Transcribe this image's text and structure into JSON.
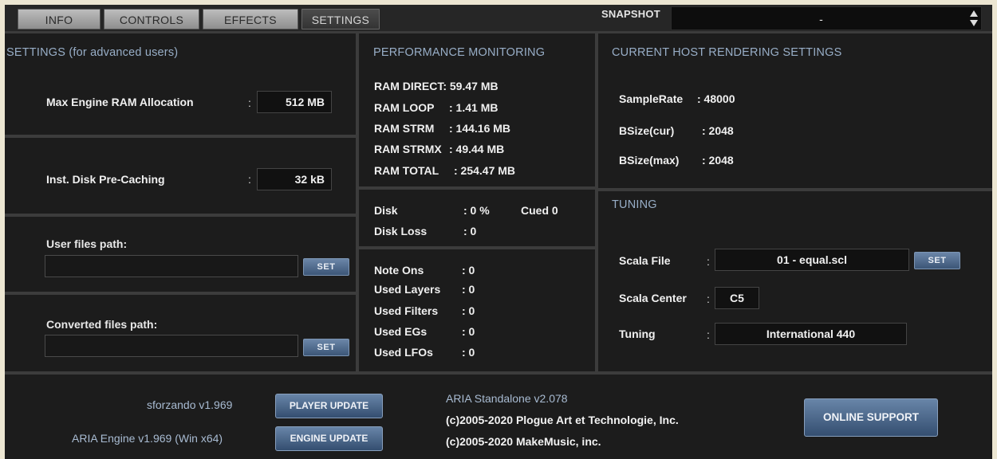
{
  "tabs": [
    "INFO",
    "CONTROLS",
    "EFFECTS",
    "SETTINGS"
  ],
  "snapshot": {
    "label": "SNAPSHOT",
    "value": "-"
  },
  "settings": {
    "title": "SETTINGS (for advanced users)",
    "ram": {
      "label": "Max Engine RAM Allocation",
      "value": "512 MB"
    },
    "disk": {
      "label": "Inst. Disk Pre-Caching",
      "value": "32 kB"
    },
    "user_path": {
      "label": "User files path:",
      "value": "",
      "button": "SET"
    },
    "converted_path": {
      "label": "Converted files path:",
      "value": "",
      "button": "SET"
    }
  },
  "performance": {
    "title": "PERFORMANCE MONITORING",
    "ram": [
      {
        "label": "RAM DIRECT",
        "value": ": 59.47 MB"
      },
      {
        "label": "RAM LOOP",
        "value": ": 1.41 MB"
      },
      {
        "label": "RAM STRM",
        "value": ": 144.16 MB"
      },
      {
        "label": "RAM STRMX",
        "value": ": 49.44 MB"
      },
      {
        "label": "RAM TOTAL",
        "value": ": 254.47 MB"
      }
    ],
    "disk": {
      "label": "Disk",
      "value": ": 0 %",
      "cued_label": "Cued",
      "cued_value": "0"
    },
    "disk_loss": {
      "label": "Disk Loss",
      "value": ": 0"
    },
    "voices": [
      {
        "label": "Note Ons",
        "value": ": 0"
      },
      {
        "label": "Used Layers",
        "value": ": 0"
      },
      {
        "label": "Used Filters",
        "value": ": 0"
      },
      {
        "label": "Used EGs",
        "value": ": 0"
      },
      {
        "label": "Used LFOs",
        "value": ": 0"
      }
    ]
  },
  "host": {
    "title": "CURRENT HOST RENDERING SETTINGS",
    "rows": [
      {
        "label": "SampleRate",
        "value": ": 48000"
      },
      {
        "label": "BSize(cur)",
        "value": ": 2048"
      },
      {
        "label": "BSize(max)",
        "value": ": 2048"
      }
    ]
  },
  "tuning": {
    "title": "TUNING",
    "scala_file": {
      "label": "Scala File",
      "value": "01 - equal.scl",
      "button": "SET"
    },
    "scala_center": {
      "label": "Scala Center",
      "value": "C5"
    },
    "tuning": {
      "label": "Tuning",
      "value": "International 440"
    }
  },
  "footer": {
    "player_version": "sforzando v1.969",
    "player_update": "PLAYER UPDATE",
    "engine_version": "ARIA Engine v1.969 (Win x64)",
    "engine_update": "ENGINE UPDATE",
    "standalone": "ARIA Standalone v2.078",
    "copyright1": "(c)2005-2020 Plogue Art et Technologie, Inc.",
    "copyright2": "(c)2005-2020 MakeMusic, inc.",
    "online_support": "ONLINE SUPPORT"
  }
}
